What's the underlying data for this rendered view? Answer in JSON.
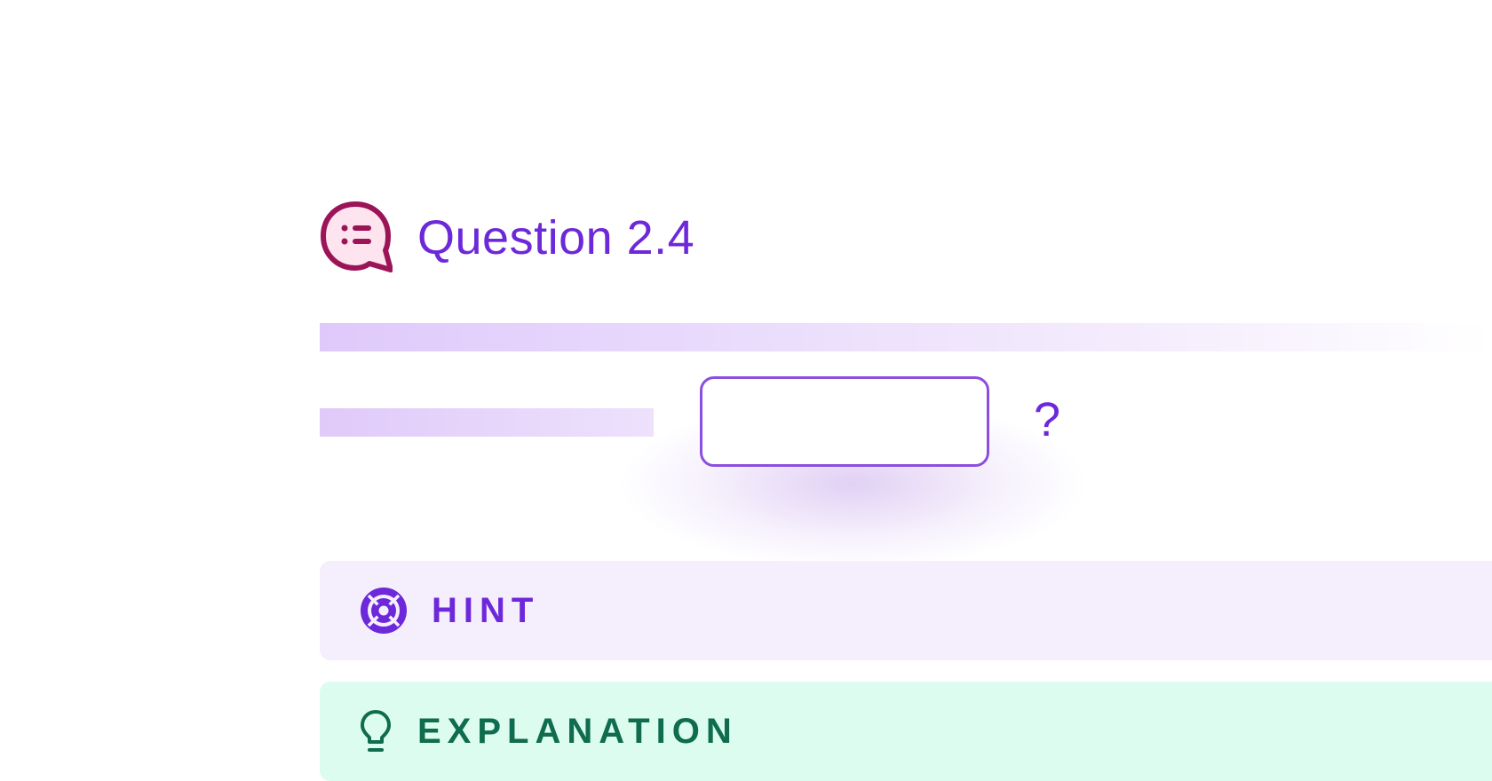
{
  "question": {
    "title": "Question 2.4",
    "icon": "chat-list-icon",
    "answer_value": "",
    "suffix": "?"
  },
  "panels": {
    "hint": {
      "label": "HINT",
      "icon": "lifebuoy-icon"
    },
    "explanation": {
      "label": "EXPLANATION",
      "icon": "lightbulb-icon"
    }
  },
  "colors": {
    "accent": "#6d28d9",
    "question_icon": "#9b1458",
    "input_border": "#8b4fe0",
    "hint_bg": "#f5effd",
    "explanation_bg": "#dcfcef",
    "explanation_text": "#0f6c4e"
  }
}
